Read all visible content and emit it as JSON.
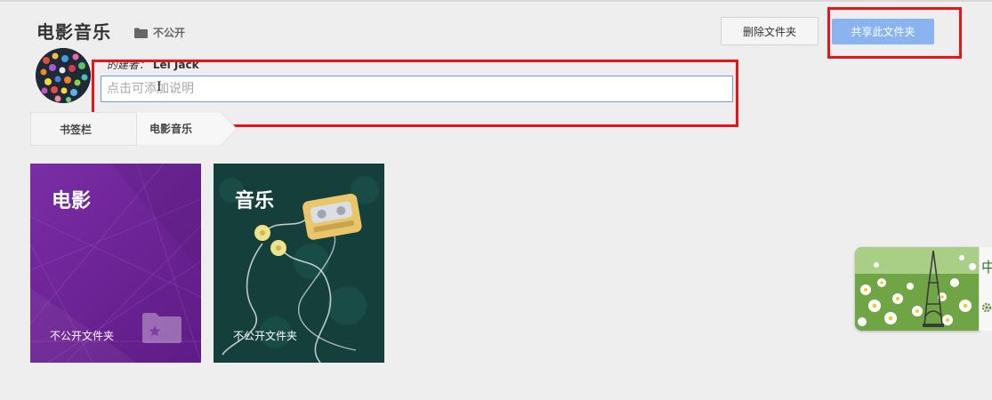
{
  "header": {
    "title": "电影音乐",
    "privacy_label": "不公开",
    "delete_button": "删除文件夹",
    "share_button": "共享此文件夹"
  },
  "creator": {
    "prefix": "的建者：",
    "name": "Lei Jack"
  },
  "description": {
    "placeholder": "点击可添加说明"
  },
  "breadcrumb": [
    "书签栏",
    "电影音乐"
  ],
  "folders": [
    {
      "name": "电影",
      "status": "不公开文件夹"
    },
    {
      "name": "音乐",
      "status": "不公开文件夹"
    }
  ],
  "widget": {
    "side_char": "中"
  },
  "colors": {
    "accent_blue": "#8ab4f0",
    "highlight_red": "#e8141b",
    "movie_tile": "#6b2293",
    "music_tile": "#123f3a"
  },
  "icons": [
    "folder-icon",
    "star-folder-icon",
    "gear-icon",
    "text-cursor-icon"
  ]
}
